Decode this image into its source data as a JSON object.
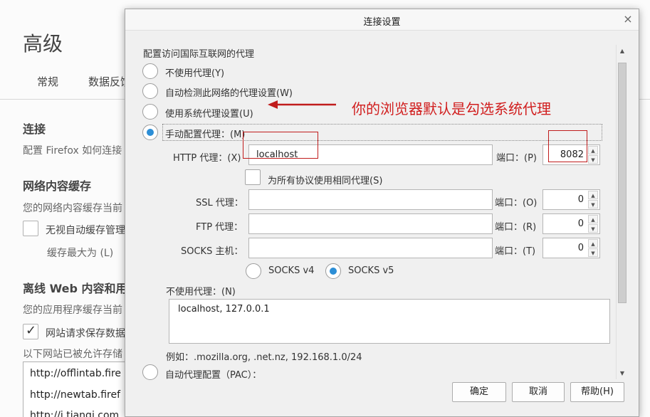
{
  "background": {
    "title": "高级",
    "tabs": [
      "常规",
      "数据反馈"
    ],
    "connection": {
      "heading": "连接",
      "desc": "配置 Firefox 如何连接"
    },
    "cache": {
      "heading": "网络内容缓存",
      "desc": "您的网络内容缓存当前",
      "override_label": "无视自动缓存管理",
      "limit_label": "缓存最大为 (L)"
    },
    "offline": {
      "heading": "离线 Web 内容和用",
      "desc": "您的应用程序缓存当前",
      "warn_label": "网站请求保存数据",
      "allowed_label": "以下网站已被允许存储"
    },
    "allowed_sites": [
      "http://offlintab.fire",
      "http://newtab.firef",
      "http://i.tianqi.com"
    ]
  },
  "dialog": {
    "title": "连接设置",
    "close_glyph": "×",
    "section_heading": "配置访问国际互联网的代理",
    "radio_no_proxy": "不使用代理(Y)",
    "radio_auto_detect": "自动检测此网络的代理设置(W)",
    "radio_system_proxy": "使用系统代理设置(U)",
    "radio_manual": "手动配置代理：(M)",
    "http_label": "HTTP 代理：(X)",
    "http_value": "localhost",
    "port_label_http": "端口：(P)",
    "http_port": "8082",
    "same_proxy_label": "为所有协议使用相同代理(S)",
    "ssl_label": "SSL 代理：",
    "ftp_label": "FTP 代理：",
    "socks_label": "SOCKS 主机：",
    "port_label_ssl": "端口：(O)",
    "port_label_ftp": "端口：(R)",
    "port_label_socks": "端口：(T)",
    "ssl_port": "0",
    "ftp_port": "0",
    "socks_port": "0",
    "socks_v4": "SOCKS v4",
    "socks_v5": "SOCKS v5",
    "no_proxy_label": "不使用代理：(N)",
    "no_proxy_value": "localhost, 127.0.0.1",
    "example": "例如：.mozilla.org, .net.nz, 192.168.1.0/24",
    "radio_pac": "自动代理配置（PAC）：",
    "ok_button": "确定",
    "cancel_button": "取消",
    "help_button": "帮助(H)"
  },
  "annotation": {
    "text": "你的浏览器默认是勾选系统代理",
    "color": "#d11e1e"
  },
  "colors": {
    "accent": "#2c8ed6",
    "annotation_red": "#c01c1c"
  }
}
